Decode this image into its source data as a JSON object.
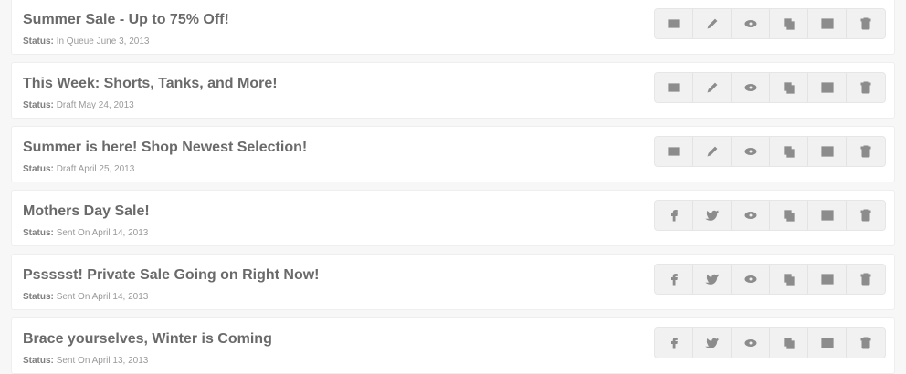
{
  "campaigns": [
    {
      "title": "Summer Sale - Up to 75% Off!",
      "status_label": "Status:",
      "status": "In Queue",
      "date": "June 3, 2013",
      "channel": "email"
    },
    {
      "title": "This Week: Shorts, Tanks, and More!",
      "status_label": "Status:",
      "status": "Draft",
      "date": "May 24, 2013",
      "channel": "email"
    },
    {
      "title": "Summer is here! Shop Newest Selection!",
      "status_label": "Status:",
      "status": "Draft",
      "date": "April 25, 2013",
      "channel": "email"
    },
    {
      "title": "Mothers Day Sale!",
      "status_label": "Status:",
      "status": "Sent On",
      "date": "April 14, 2013",
      "channel": "social"
    },
    {
      "title": "Pssssst! Private Sale Going on Right Now!",
      "status_label": "Status:",
      "status": "Sent On",
      "date": "April 14, 2013",
      "channel": "social"
    },
    {
      "title": "Brace yourselves, Winter is Coming",
      "status_label": "Status:",
      "status": "Sent On",
      "date": "April 13, 2013",
      "channel": "social"
    }
  ],
  "icons": {
    "email_actions": [
      "envelope-icon",
      "pencil-icon",
      "eye-icon",
      "copy-icon",
      "chart-icon",
      "trash-icon"
    ],
    "social_actions": [
      "facebook-icon",
      "twitter-icon",
      "eye-icon",
      "copy-icon",
      "chart-icon",
      "trash-icon"
    ]
  }
}
